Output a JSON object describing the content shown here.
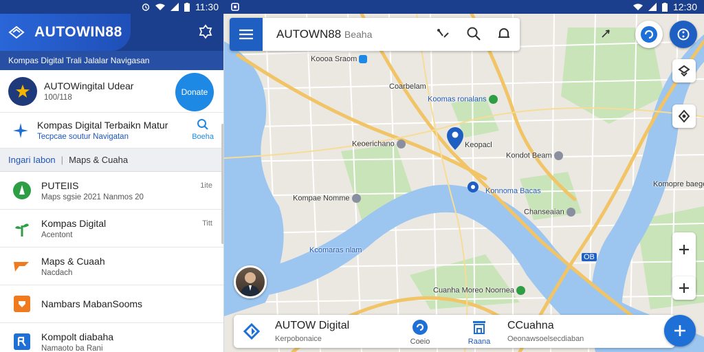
{
  "status_left": {
    "time": "11:30"
  },
  "status_right": {
    "time": "12:30"
  },
  "app": {
    "title": "AUTOWIN88",
    "subtitle": "Kompas Digital Trali Jalalar Navigasan"
  },
  "featured": {
    "title": "AUTOWingital Udear",
    "meta": "100/118",
    "cta_label": "Donate"
  },
  "promo": {
    "title": "Kompas Digital Terbaikn Matur",
    "subtitle": "Tecpcae soutur Navigatan",
    "search_label": "Boeha"
  },
  "tabs": {
    "active": "Ingari Iabon",
    "other": "Maps & Cuaha"
  },
  "list": [
    {
      "title": "PUTEIIS",
      "subtitle": "Maps sgsie 2021 Nanmos 20",
      "meta": "1ite"
    },
    {
      "title": "Kompas Digital",
      "subtitle": "Acentont",
      "meta": "Titt"
    },
    {
      "title": "Maps & Cuaah",
      "subtitle": "Nacdach",
      "meta": ""
    },
    {
      "title": "Nambars MabanSooms",
      "subtitle": "",
      "meta": ""
    },
    {
      "title": "Kompolt diabaha",
      "subtitle": "Namaoto ba Rani",
      "meta": ""
    }
  ],
  "search": {
    "brand": "AUTOWN88",
    "placeholder": "Beaha"
  },
  "map_labels": {
    "l1": "Koooa Sraom",
    "l2": "Coarbelam",
    "l3": "Koomas ronalans",
    "l4": "Keoerichano",
    "l5": "Keopacl",
    "l6": "Kondot Beam",
    "l7": "Kompae Nomme",
    "l8": "Konnoma Bacas",
    "l9": "Komopre baegen",
    "l10": "Chanseaian",
    "l11": "Kcomaras nlam",
    "l12": "Cuanha Moreo Noornea",
    "l13": "OB"
  },
  "bottom_card": {
    "name": "AUTOW Digital",
    "sub": "Kerpobonaice",
    "action_1": "Coeio",
    "action_2": "Raana",
    "dest_title": "CCuahna",
    "dest_sub": "Oeonawsoelsecdiaban"
  },
  "colors": {
    "primary": "#1b3f8c",
    "accent": "#1e88e5",
    "water": "#9cc6f0",
    "park": "#c9e4b8",
    "road": "#f1c467"
  }
}
